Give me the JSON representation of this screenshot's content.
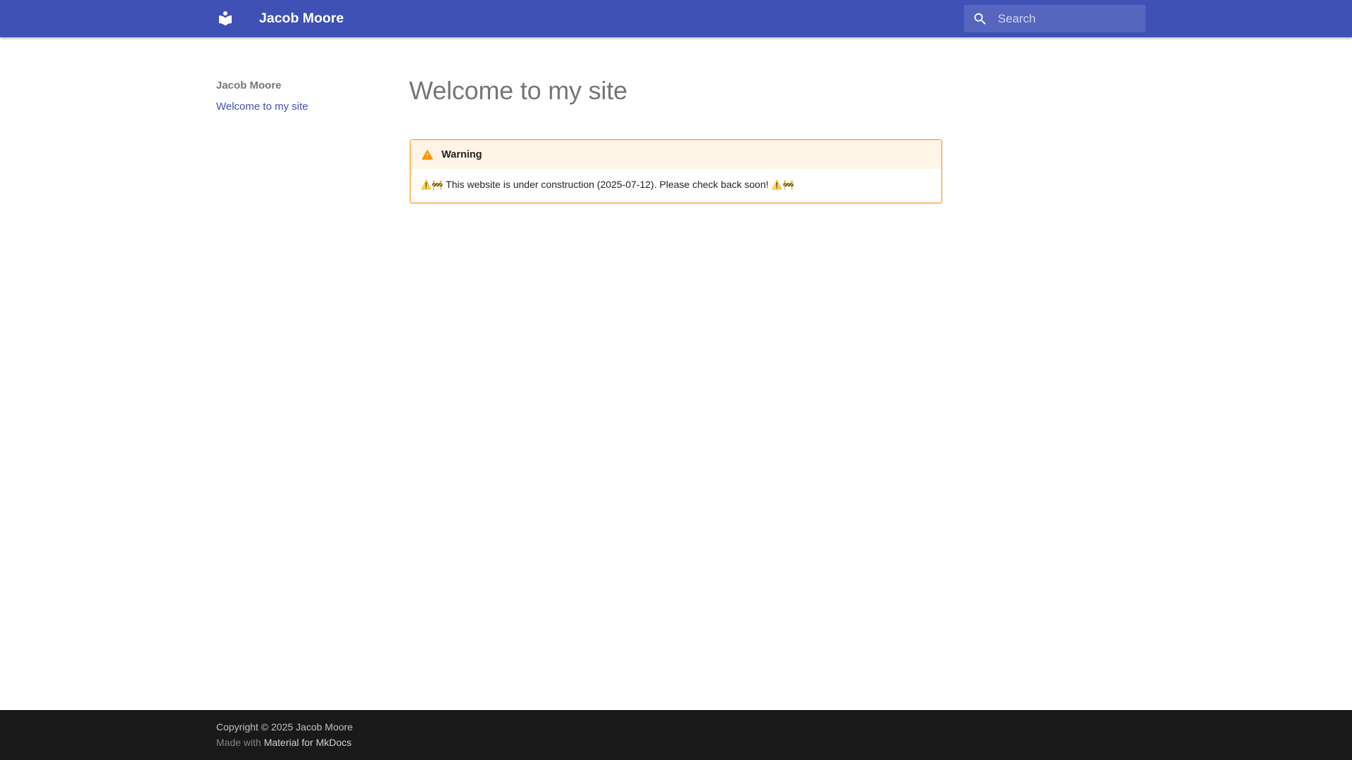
{
  "header": {
    "title": "Jacob Moore",
    "logo_icon": "book-open-icon",
    "background_color": "#3f51b5"
  },
  "search": {
    "placeholder": "Search",
    "icon": "search-icon"
  },
  "sidebar": {
    "title": "Jacob Moore",
    "items": [
      {
        "label": "Welcome to my site"
      }
    ]
  },
  "main": {
    "title": "Welcome to my site",
    "admonition": {
      "type": "warning",
      "title": "Warning",
      "icon": "warning-icon",
      "leading_emojis": "⚠️🚧",
      "text": "This website is under construction (2025-07-12). Please check back soon!",
      "trailing_emojis": "⚠️🚧",
      "border_color": "#ff9100",
      "header_color": "#fff4e5"
    }
  },
  "footer": {
    "copyright": "Copyright © 2025 Jacob Moore",
    "made_with_prefix": "Made with",
    "made_with_link": "Material for MkDocs",
    "background_color": "#191919"
  }
}
